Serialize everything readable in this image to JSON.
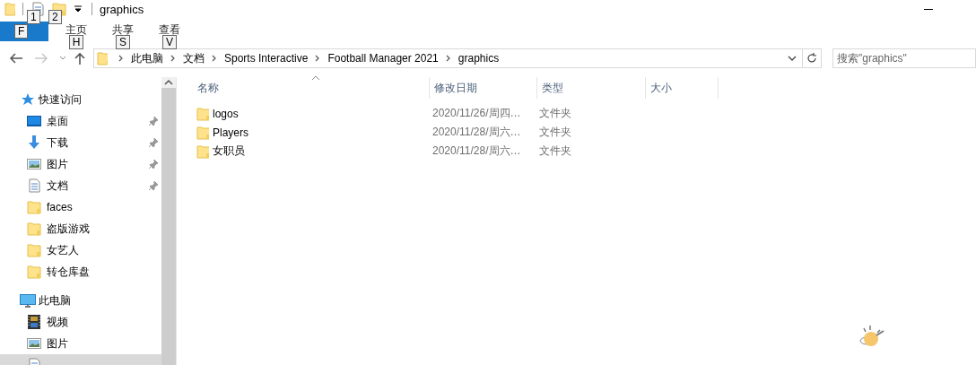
{
  "window": {
    "title": "graphics"
  },
  "quick_access_toolbar": [
    {
      "kind": "document",
      "keytip": "1"
    },
    {
      "kind": "folder",
      "keytip": "2"
    }
  ],
  "ribbon": {
    "file_tab": {
      "keytip": "F"
    },
    "tabs": [
      {
        "label": "主页",
        "keytip": "H"
      },
      {
        "label": "共享",
        "keytip": "S"
      },
      {
        "label": "查看",
        "keytip": "V"
      }
    ]
  },
  "navigation": {
    "back_enabled": true,
    "forward_enabled": false
  },
  "address_bar": {
    "segments": [
      "此电脑",
      "文档",
      "Sports Interactive",
      "Football Manager 2021",
      "graphics"
    ]
  },
  "search": {
    "placeholder": "搜索\"graphics\""
  },
  "sidebar": {
    "sections": [
      {
        "label": "快速访问",
        "kind": "star",
        "items": [
          {
            "label": "桌面",
            "kind": "desktop",
            "pinned": true,
            "selected": false
          },
          {
            "label": "下载",
            "kind": "download",
            "pinned": true,
            "selected": false
          },
          {
            "label": "图片",
            "kind": "pictures",
            "pinned": true,
            "selected": false
          },
          {
            "label": "文档",
            "kind": "documents",
            "pinned": true,
            "selected": false
          },
          {
            "label": "faces",
            "kind": "folder",
            "pinned": false,
            "selected": false
          },
          {
            "label": "盗版游戏",
            "kind": "folder",
            "pinned": false,
            "selected": false
          },
          {
            "label": "女艺人",
            "kind": "folder",
            "pinned": false,
            "selected": false
          },
          {
            "label": "转仓库盘",
            "kind": "folder",
            "pinned": false,
            "selected": false
          }
        ]
      },
      {
        "label": "此电脑",
        "kind": "pc",
        "items": [
          {
            "label": "视频",
            "kind": "videos",
            "pinned": false,
            "selected": false
          },
          {
            "label": "图片",
            "kind": "pictures",
            "pinned": false,
            "selected": false
          },
          {
            "kind": "documents",
            "pinned": false,
            "selected": true
          }
        ]
      }
    ]
  },
  "table": {
    "columns": [
      {
        "label": "名称",
        "sorted": true
      },
      {
        "label": "修改日期",
        "sorted": false
      },
      {
        "label": "类型",
        "sorted": false
      },
      {
        "label": "大小",
        "sorted": false
      }
    ],
    "rows": [
      {
        "name": "logos",
        "date": "2020/11/26/周四…",
        "type": "文件夹"
      },
      {
        "name": "Players",
        "date": "2020/11/28/周六…",
        "type": "文件夹"
      },
      {
        "name": "女职员",
        "date": "2020/11/28/周六…",
        "type": "文件夹"
      }
    ]
  }
}
